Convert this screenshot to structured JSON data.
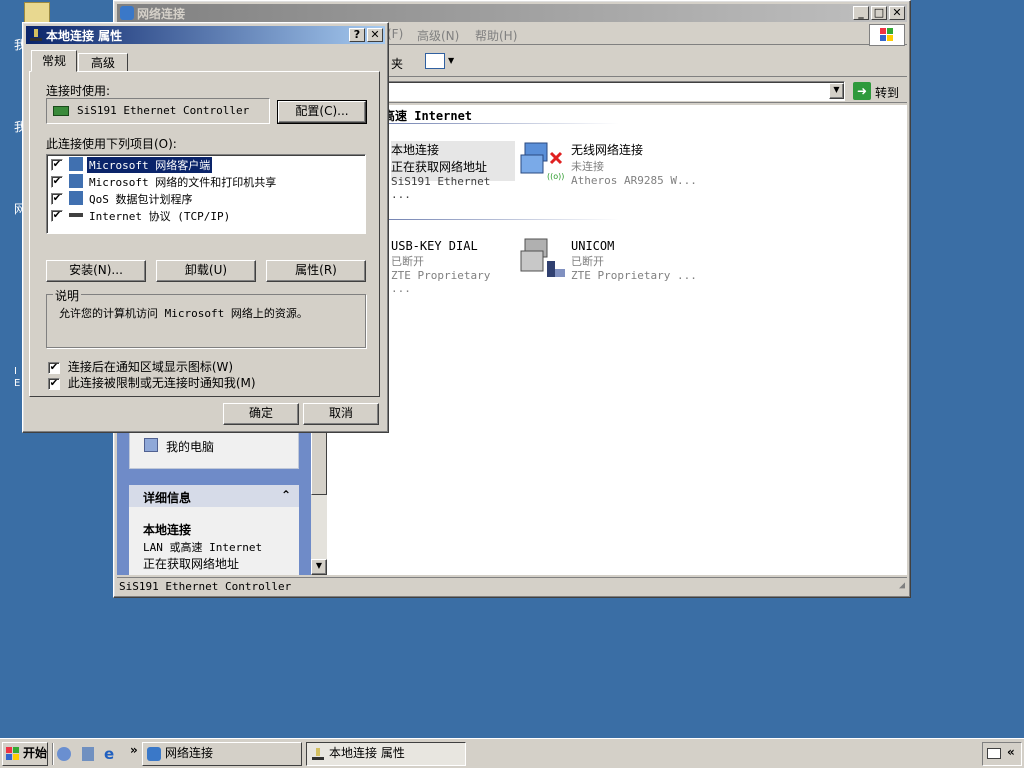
{
  "desktop": {
    "icons": [
      "我",
      "我",
      "网",
      "I",
      "E"
    ]
  },
  "net_window": {
    "title": "网络连接",
    "menu": [
      "(F)",
      "高级(N)",
      "帮助(H)"
    ],
    "toolbar_folders": "夹",
    "go_label": "转到",
    "group1_header": "高速 Internet",
    "connections": [
      {
        "name": "本地连接",
        "status": "正在获取网络地址",
        "device": "SiS191 Ethernet ..."
      },
      {
        "name": "无线网络连接",
        "status": "未连接",
        "device": "Atheros AR9285 W..."
      },
      {
        "name": "USB-KEY DIAL",
        "status": "已断开",
        "device": "ZTE Proprietary ..."
      },
      {
        "name": "UNICOM",
        "status": "已断开",
        "device": "ZTE Proprietary ..."
      }
    ],
    "left_panel": {
      "my_computer": "我的电脑",
      "details_header": "详细信息",
      "details_name": "本地连接",
      "details_type": "LAN 或高速 Internet",
      "details_status": "正在获取网络地址"
    },
    "statusbar": "SiS191 Ethernet Controller"
  },
  "dialog": {
    "title": "本地连接 属性",
    "tabs": [
      "常规",
      "高级"
    ],
    "connect_using_label": "连接时使用:",
    "adapter": "SiS191 Ethernet Controller",
    "configure_button": "配置(C)...",
    "items_label": "此连接使用下列项目(O):",
    "items": [
      {
        "label": "Microsoft 网络客户端",
        "checked": true
      },
      {
        "label": "Microsoft 网络的文件和打印机共享",
        "checked": true
      },
      {
        "label": "QoS 数据包计划程序",
        "checked": true
      },
      {
        "label": "Internet 协议 (TCP/IP)",
        "checked": true
      }
    ],
    "install_button": "安装(N)...",
    "uninstall_button": "卸载(U)",
    "properties_button": "属性(R)",
    "description_legend": "说明",
    "description_text": "允许您的计算机访问 Microsoft 网络上的资源。",
    "option_show_icon": "连接后在通知区域显示图标(W)",
    "option_notify": "此连接被限制或无连接时通知我(M)",
    "ok_button": "确定",
    "cancel_button": "取消",
    "check_mark": "✔"
  },
  "taskbar": {
    "start": "开始",
    "more": "»",
    "tasks": [
      "网络连接",
      "本地连接 属性"
    ],
    "tray_arrow": "«"
  }
}
